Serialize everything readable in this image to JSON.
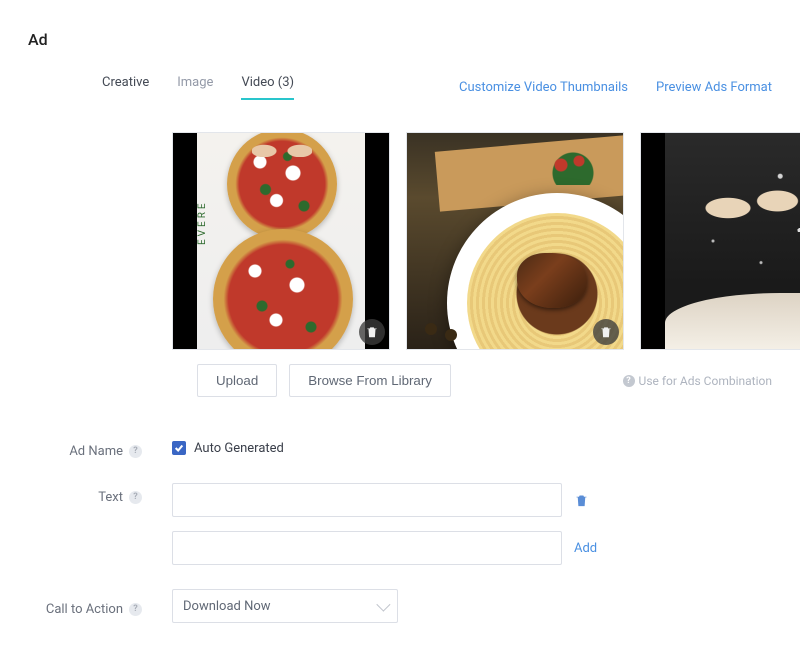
{
  "section_title": "Ad",
  "tabs": {
    "creative": "Creative",
    "image": "Image",
    "video": "Video (3)"
  },
  "tab_links": {
    "customize": "Customize Video Thumbnails",
    "preview": "Preview Ads Format"
  },
  "thumbs": {
    "pizza_brand": "EVERE"
  },
  "actions": {
    "upload": "Upload",
    "browse": "Browse From Library",
    "combo_hint": "Use for Ads Combination"
  },
  "form": {
    "ad_name_label": "Ad Name",
    "auto_generated": "Auto Generated",
    "text_label": "Text",
    "add": "Add",
    "cta_label": "Call to Action",
    "cta_value": "Download Now"
  }
}
